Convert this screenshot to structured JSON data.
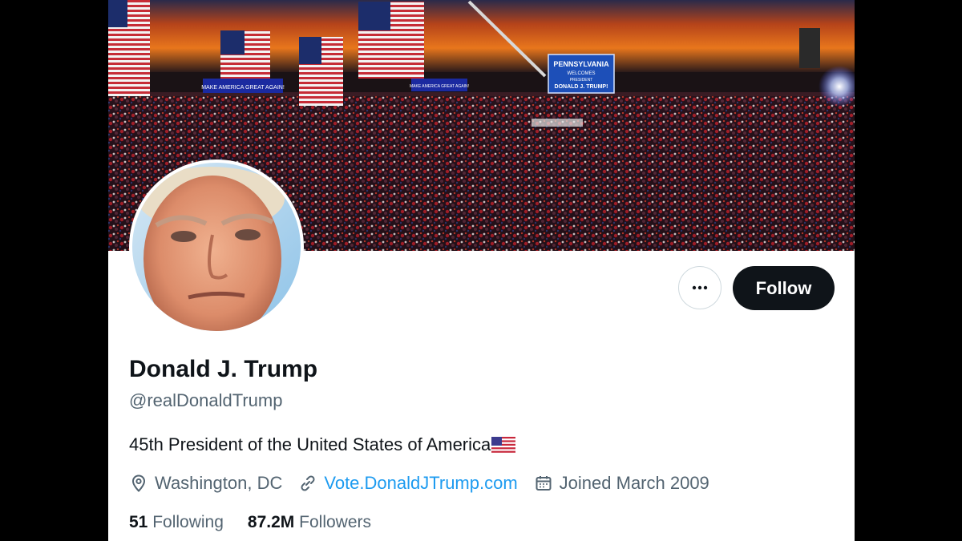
{
  "banner": {
    "flag_sign_text": "MAKE AMERICA GREAT AGAIN!",
    "screen_text": [
      "PENNSYLVANIA",
      "WELCOMES",
      "PRESIDENT",
      "DONALD J. TRUMP!"
    ]
  },
  "profile": {
    "name": "Donald J. Trump",
    "handle": "@realDonaldTrump",
    "bio": "45th President of the United States of America",
    "location": "Washington, DC",
    "website": "Vote.DonaldJTrump.com",
    "joined": "Joined March 2009"
  },
  "stats": {
    "following_count": "51",
    "following_label": "Following",
    "followers_count": "87.2M",
    "followers_label": "Followers"
  },
  "actions": {
    "follow_label": "Follow",
    "more_icon": "more-horizontal-icon"
  },
  "icons": {
    "location": "location-pin-icon",
    "website": "link-icon",
    "joined": "calendar-icon",
    "bio_flag": "us-flag-icon"
  },
  "colors": {
    "follow_bg": "#0f1419",
    "link": "#1d9bf0",
    "secondary_text": "#536471",
    "primary_text": "#0f1419"
  }
}
